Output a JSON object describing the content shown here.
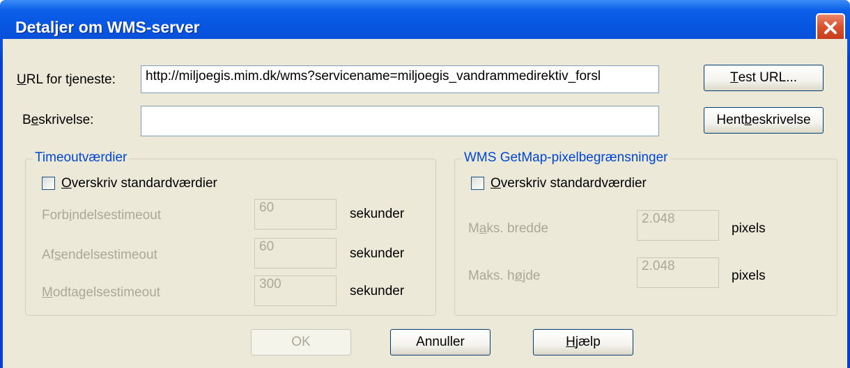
{
  "window": {
    "title": "Detaljer om WMS-server"
  },
  "url_field": {
    "label_pre": "",
    "label_ul": "U",
    "label_post": "RL for tjeneste:",
    "value": "http://miljoegis.mim.dk/wms?servicename=miljoegis_vandrammedirektiv_forsl"
  },
  "description_field": {
    "label_pre": "B",
    "label_ul": "e",
    "label_post": "skrivelse:",
    "value": ""
  },
  "buttons": {
    "test_url_pre": "",
    "test_url_ul": "T",
    "test_url_post": "est URL...",
    "fetch_desc_pre": "Hent ",
    "fetch_desc_ul": "b",
    "fetch_desc_post": "eskrivelse",
    "ok": "OK",
    "cancel": "Annuller",
    "help_pre": "",
    "help_ul": "H",
    "help_post": "jælp"
  },
  "timeouts": {
    "title": "Timeoutværdier",
    "override_pre": "",
    "override_ul": "O",
    "override_post": "verskriv standardværdier",
    "rows": [
      {
        "label_pre": "Forb",
        "label_ul": "i",
        "label_post": "ndelsestimeout",
        "value": "60",
        "unit": "sekunder"
      },
      {
        "label_pre": "Af",
        "label_ul": "s",
        "label_post": "endelsestimeout",
        "value": "60",
        "unit": "sekunder"
      },
      {
        "label_pre": "",
        "label_ul": "M",
        "label_post": "odtagelsestimeout",
        "value": "300",
        "unit": "sekunder"
      }
    ]
  },
  "pixel_limits": {
    "title": "WMS GetMap-pixelbegrænsninger",
    "override_pre": "",
    "override_ul": "O",
    "override_post": "verskriv standardværdier",
    "rows": [
      {
        "label_pre": "M",
        "label_ul": "a",
        "label_post": "ks. bredde",
        "value": "2.048",
        "unit": "pixels"
      },
      {
        "label_pre": "Maks. h",
        "label_ul": "ø",
        "label_post": "jde",
        "value": "2.048",
        "unit": "pixels"
      }
    ]
  },
  "icons": {
    "close": "close-icon"
  },
  "colors": {
    "title_bar": "#0754df",
    "close_button": "#d9532f",
    "group_title": "#0046d5",
    "dialog_bg": "#ece9d8"
  }
}
